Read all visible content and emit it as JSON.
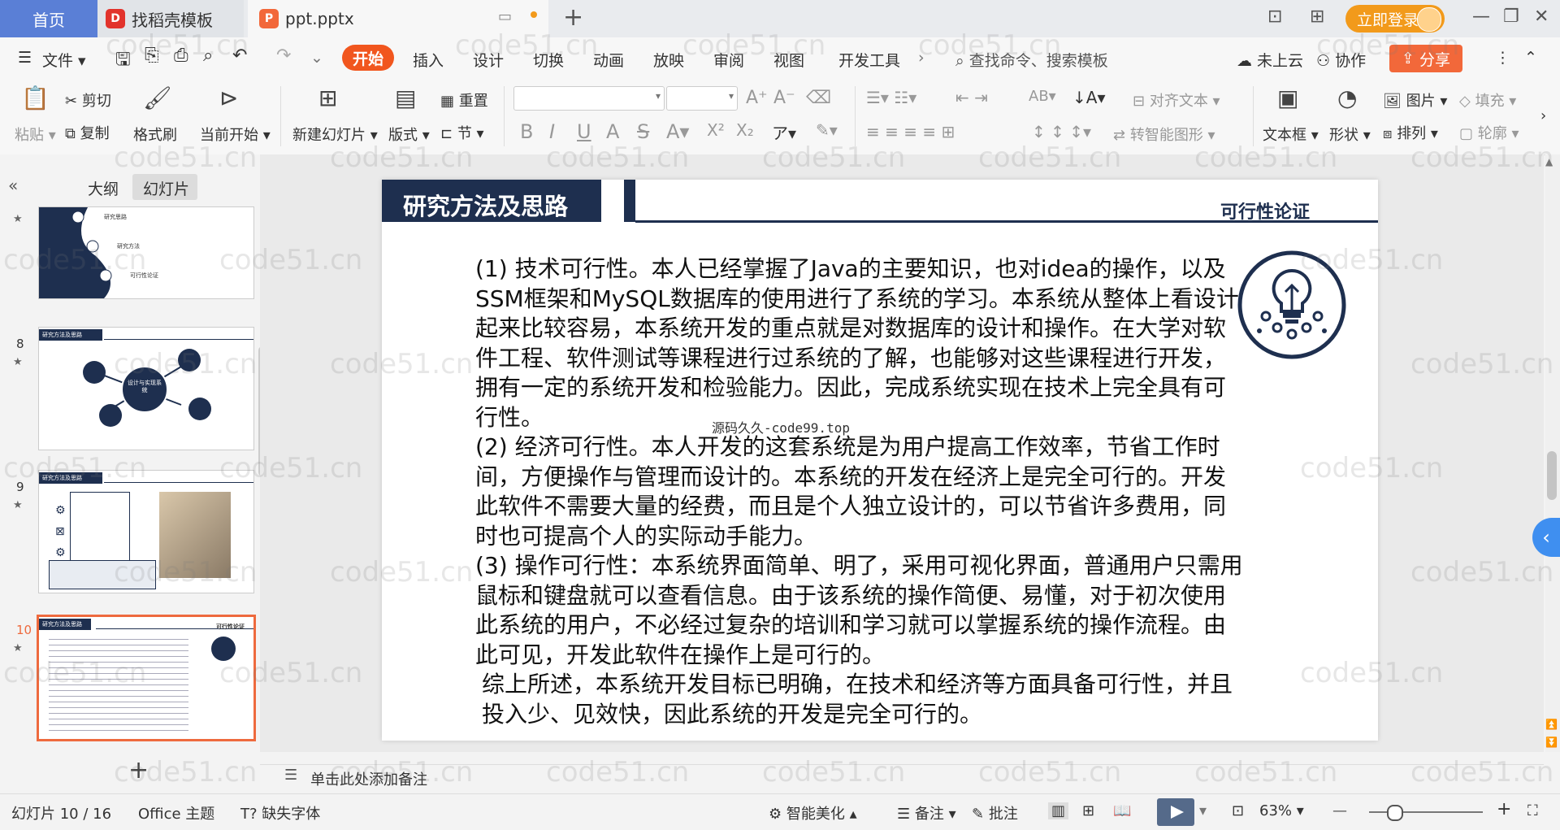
{
  "titlebar": {
    "home_tab": "首页",
    "docer_tab": "找稻壳模板",
    "file_tab": "ppt.pptx",
    "new_tab_icon": "plus-icon",
    "login_button": "立即登录",
    "accent": "#f29a1b"
  },
  "menubar": {
    "file": "文件",
    "items": [
      "开始",
      "插入",
      "设计",
      "切换",
      "动画",
      "放映",
      "审阅",
      "视图",
      "开发工具"
    ],
    "active": "开始",
    "search_placeholder": "查找命令、搜索模板",
    "cloud": "未上云",
    "collab": "协作",
    "share": "分享"
  },
  "ribbon": {
    "paste": "粘贴",
    "cut": "剪切",
    "copy": "复制",
    "format_painter": "格式刷",
    "play_from_current": "当前开始",
    "new_slide": "新建幻灯片",
    "layout": "版式",
    "section": "节",
    "reset": "重置",
    "align_text": "对齐文本",
    "smart_art": "转智能图形",
    "text_box": "文本框",
    "shape": "形状",
    "picture": "图片",
    "arrange": "排列",
    "fill": "填充",
    "outline": "轮廓",
    "superscript": "X²",
    "subscript": "X₂"
  },
  "leftpanel": {
    "outline_tab": "大纲",
    "slides_tab": "幻灯片",
    "thumbs": [
      {
        "num": "",
        "items": [
          "研究思路",
          "研究方法",
          "可行性论证"
        ]
      },
      {
        "num": "8",
        "title": "研究方法及思路",
        "center": "设计与实现系统"
      },
      {
        "num": "9",
        "title": "研究方法及思路"
      },
      {
        "num": "10",
        "title": "研究方法及思路",
        "sub": "可行性论证"
      }
    ],
    "add_icon": "plus-icon"
  },
  "slide": {
    "title": "研究方法及思路",
    "subtitle": "可行性论证",
    "watermark_text": "源码久久-code99.top",
    "paragraphs": [
      "(1) 技术可行性。本人已经掌握了Java的主要知识，也对idea的操作，以及SSM框架和MySQL数据库的使用进行了系统的学习。本系统从整体上看设计起来比较容易，本系统开发的重点就是对数据库的设计和操作。在大学对软件工程、软件测试等课程进行过系统的了解，也能够对这些课程进行开发，拥有一定的系统开发和检验能力。因此，完成系统实现在技术上完全具有可行性。",
      "(2) 经济可行性。本人开发的这套系统是为用户提高工作效率，节省工作时间，方便操作与管理而设计的。本系统的开发在经济上是完全可行的。开发此软件不需要大量的经费，而且是个人独立设计的，可以节省许多费用，同时也可提高个人的实际动手能力。",
      "(3) 操作可行性：本系统界面简单、明了，采用可视化界面，普通用户只需用鼠标和键盘就可以查看信息。由于该系统的操作简便、易懂，对于初次使用此系统的用户，不必经过复杂的培训和学习就可以掌握系统的操作流程。由此可见，开发此软件在操作上是可行的。",
      "综上所述，本系统开发目标已明确，在技术和经济等方面具备可行性，并且投入少、见效快，因此系统的开发是完全可行的。"
    ],
    "theme_color": "#1e2f4f"
  },
  "notes": {
    "placeholder": "单击此处添加备注"
  },
  "statusbar": {
    "slide_counter": "幻灯片 10 / 16",
    "theme": "Office 主题",
    "missing_font": "缺失字体",
    "smart_beautify": "智能美化",
    "notes": "备注",
    "comment": "批注",
    "zoom": "63%"
  },
  "watermark": "code51.cn"
}
